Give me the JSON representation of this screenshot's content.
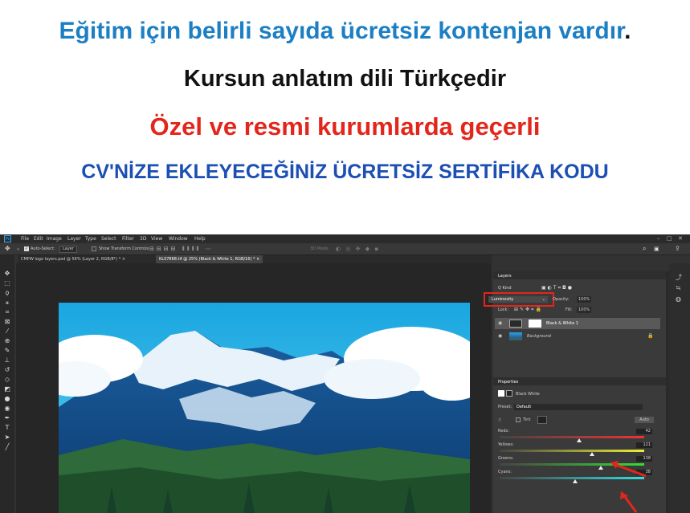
{
  "banner": {
    "line1": "Eğitim için belirli sayıda ücretsiz kontenjan vardır",
    "line1_dot": ".",
    "line2": "Kursun anlatım dili Türkçedir",
    "line3": "Özel ve resmi kurumlarda geçerli",
    "line4": "CV'NİZE EKLEYECEĞİNİZ ÜCRETSİZ SERTİFİKA KODU",
    "colors": {
      "line1": "#1c7fc4",
      "line2": "#111111",
      "line3": "#e3261b",
      "line4": "#1b4fb4"
    }
  },
  "photoshop": {
    "menu": [
      "File",
      "Edit",
      "Image",
      "Layer",
      "Type",
      "Select",
      "Filter",
      "3D",
      "View",
      "Window",
      "Help"
    ],
    "options": {
      "auto_select": "Auto-Select:",
      "auto_select_value": "Layer",
      "show_transform": "Show Transform Controls",
      "mode3d": "3D Mode:"
    },
    "tabs": [
      "CMPW logo layers.psd @ 56% (Layer 2, RGB/8*) *",
      "KL07868.tif @ 25% (Black & White 1, RGB/16) *"
    ],
    "layers_panel": {
      "title": "Layers",
      "kind": "Q Kind",
      "blend_mode": "Luminosity",
      "opacity_label": "Opacity:",
      "opacity": "100%",
      "lock_label": "Lock:",
      "fill_label": "Fill:",
      "fill": "100%",
      "layers": [
        {
          "name": "Black & White 1",
          "selected": true
        },
        {
          "name": "Background",
          "selected": false
        }
      ]
    },
    "properties_panel": {
      "title": "Properties",
      "type": "Black White",
      "preset_label": "Preset:",
      "preset": "Default",
      "tint": "Tint",
      "auto": "Auto",
      "sliders": [
        {
          "name": "Reds:",
          "value": 42,
          "gradient": "linear-gradient(90deg,#444,#e33)"
        },
        {
          "name": "Yellows:",
          "value": 121,
          "gradient": "linear-gradient(90deg,#444,#ee3)"
        },
        {
          "name": "Greens:",
          "value": 138,
          "gradient": "linear-gradient(90deg,#444,#3d3)"
        },
        {
          "name": "Cyans:",
          "value": 38,
          "gradient": "linear-gradient(90deg,#444,#3dd)"
        }
      ],
      "slider_positions": [
        0.55,
        0.64,
        0.7,
        0.52
      ]
    },
    "colors": {
      "accent": "#31a8ff",
      "highlight_box": "#e3261b",
      "panel": "#3a3a3a"
    }
  }
}
